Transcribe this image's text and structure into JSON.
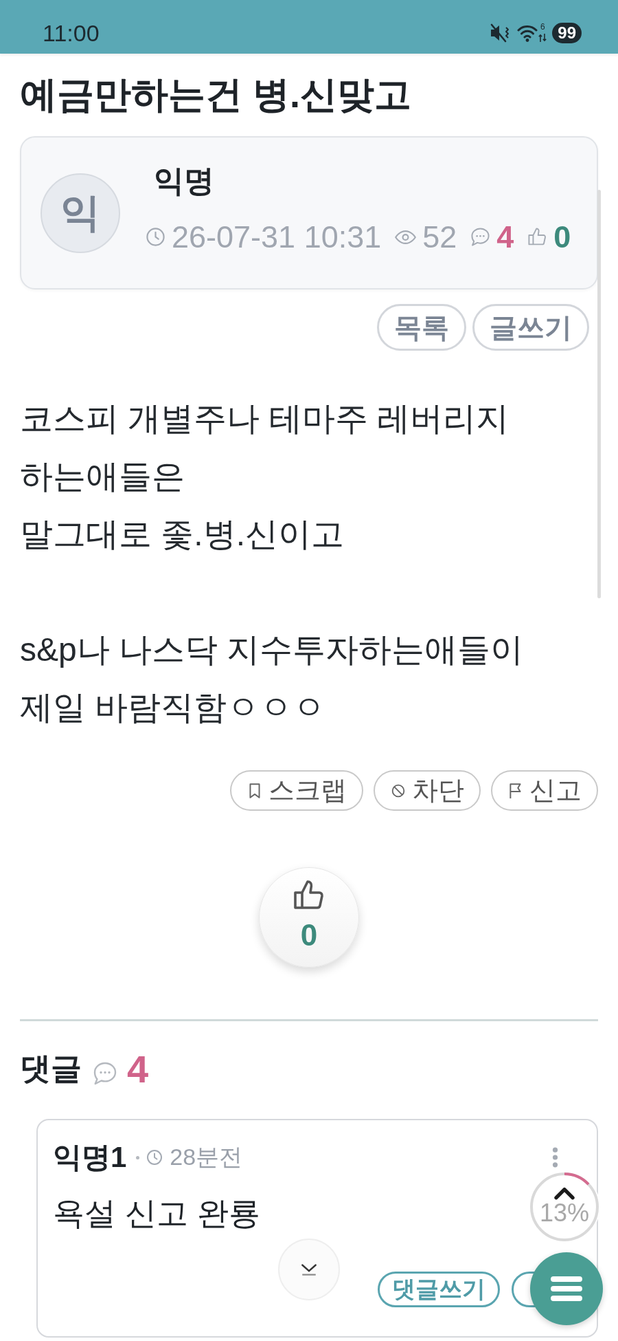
{
  "status_bar": {
    "time": "11:00",
    "wifi_generation": "6",
    "battery": "99"
  },
  "post": {
    "title": "예금만하는건 병.신맞고",
    "author": {
      "avatar_letter": "익",
      "name": "익명"
    },
    "meta": {
      "datetime": "26-07-31 10:31",
      "views": "52",
      "comments": "4",
      "likes": "0"
    },
    "top_buttons": [
      "목록",
      "글쓰기"
    ],
    "body": "코스피 개별주나 테마주 레버리지\n하는애들은\n말그대로 좇.병.신이고\n\ns&p나 나스닥 지수투자하는애들이\n제일 바람직함ㅇㅇㅇ",
    "actions": [
      {
        "kind": "bookmark",
        "label": "스크랩"
      },
      {
        "kind": "block",
        "label": "차단"
      },
      {
        "kind": "report",
        "label": "신고"
      }
    ],
    "like_button": {
      "count": "0"
    }
  },
  "comments": {
    "heading": "댓글",
    "count": "4",
    "items": [
      {
        "author": "익명1",
        "time": "28분전",
        "text": "욕설 신고 완룡",
        "reply_label": "댓글쓰기"
      }
    ]
  },
  "scroll_progress": {
    "level": 0.13,
    "label": "13%"
  }
}
